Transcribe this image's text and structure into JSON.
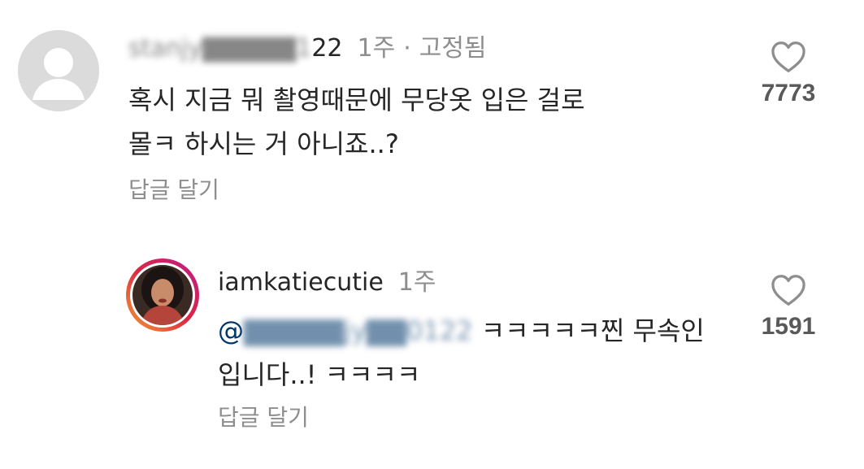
{
  "comments": [
    {
      "username_visible_tail": "22",
      "time": "1주",
      "separator": "·",
      "pinned_label": "고정됨",
      "text_line1": "혹시 지금 뭐 촬영때문에 무당옷 입은 걸로",
      "text_line2": "몰ㅋ 하시는 거 아니죠..?",
      "reply_label": "답글 달기",
      "likes": "7773"
    },
    {
      "username": "iamkatiecutie",
      "time": "1주",
      "mention_prefix": "@",
      "text_after_mention": "ㅋㅋㅋㅋㅋ찐 무속인",
      "text_line2": "입니다..! ㅋㅋㅋㅋ",
      "reply_label": "답글 달기",
      "likes": "1591"
    }
  ],
  "icons": {
    "heart": "heart-outline-icon",
    "default_avatar": "default-avatar-icon"
  },
  "colors": {
    "text": "#262626",
    "muted": "#8e8e8e",
    "mention": "#00376b",
    "avatar_placeholder": "#dbdbdb"
  }
}
